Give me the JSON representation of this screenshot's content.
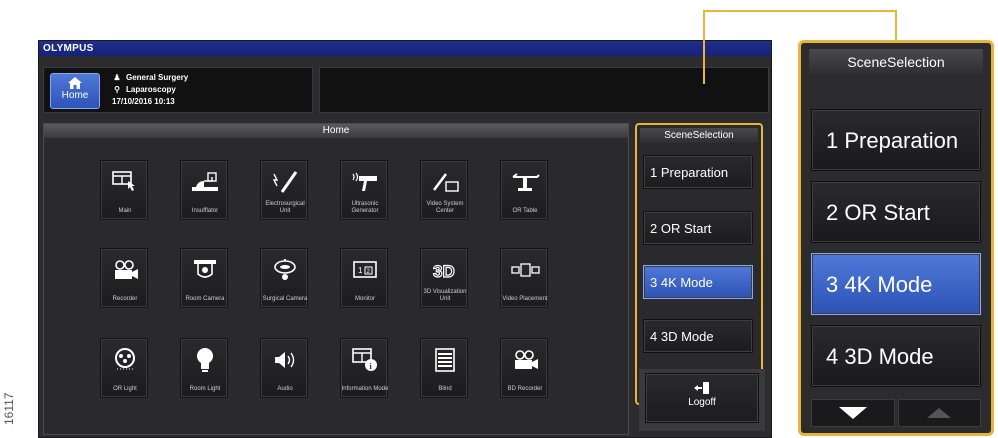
{
  "figure_id": "16117",
  "brand": "OLYMPUS",
  "header": {
    "home_label": "Home",
    "procedure": "General Surgery",
    "technique": "Laparoscopy",
    "datetime": "17/10/2016   10:13"
  },
  "home_panel": {
    "title": "Home",
    "tiles": [
      {
        "label": "Main",
        "icon": "main-icon"
      },
      {
        "label": "Insufflator",
        "icon": "insufflator-icon"
      },
      {
        "label": "Electrosurgical Unit",
        "icon": "electrosurgical-icon"
      },
      {
        "label": "Ultrasonic Generator",
        "icon": "ultrasonic-icon"
      },
      {
        "label": "Video System Center",
        "icon": "video-system-icon"
      },
      {
        "label": "OR Table",
        "icon": "or-table-icon"
      },
      {
        "label": "Recorder",
        "icon": "recorder-icon"
      },
      {
        "label": "Room Camera",
        "icon": "room-camera-icon"
      },
      {
        "label": "Surgical Camera",
        "icon": "surgical-camera-icon"
      },
      {
        "label": "Monitor",
        "icon": "monitor-icon"
      },
      {
        "label": "3D Visualization Unit",
        "icon": "3d-unit-icon"
      },
      {
        "label": "Video Placement",
        "icon": "video-placement-icon"
      },
      {
        "label": "OR Light",
        "icon": "or-light-icon"
      },
      {
        "label": "Room Light",
        "icon": "room-light-icon"
      },
      {
        "label": "Audio",
        "icon": "audio-icon"
      },
      {
        "label": "Information Mode",
        "icon": "information-icon"
      },
      {
        "label": "Blind",
        "icon": "blind-icon"
      },
      {
        "label": "BD Recorder",
        "icon": "bd-recorder-icon"
      }
    ]
  },
  "scene_selection": {
    "title": "SceneSelection",
    "items": [
      {
        "label": "1 Preparation",
        "active": false
      },
      {
        "label": "2 OR Start",
        "active": false
      },
      {
        "label": "3 4K Mode",
        "active": true
      },
      {
        "label": "4 3D Mode",
        "active": false
      }
    ]
  },
  "logoff_label": "Logoff",
  "colors": {
    "accent": "#2c53b6",
    "highlight": "#e9b43a",
    "brand_bar": "#1f2f8c"
  }
}
